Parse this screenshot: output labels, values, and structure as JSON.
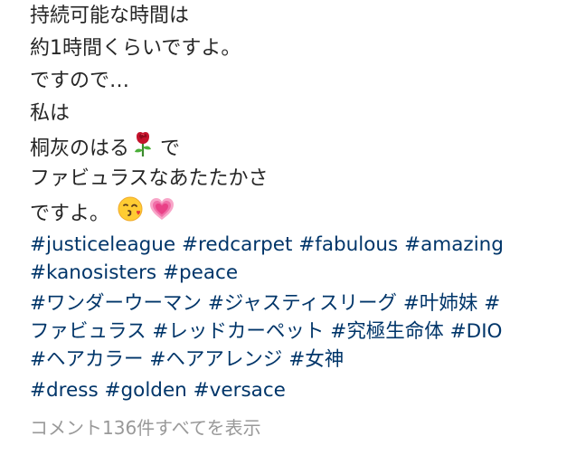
{
  "caption": {
    "lines": [
      "持続可能な時間は",
      "約1時間くらいですよ。",
      "ですので…",
      "私は",
      "桐灰のはる",
      "ファビュラスなあたたかさ",
      "ですよ。"
    ],
    "line5_suffix": "で",
    "emojis": [
      "rose-emoji",
      "kissing-face-emoji",
      "growing-heart-emoji"
    ]
  },
  "hashtags": {
    "rows": [
      [
        "#justiceleague",
        "#redcarpet",
        "#fabulous",
        "#amazing"
      ],
      [
        "#kanosisters",
        "#peace"
      ],
      [
        "#ワンダーウーマン",
        "#ジャスティスリーグ",
        "#叶姉妹",
        "#"
      ],
      [
        "ファビュラス",
        "#レッドカーペット",
        "#究極生命体",
        "#DIO"
      ],
      [
        "#ヘアカラー",
        "#ヘアアレンジ",
        "#女神"
      ],
      [
        "#dress",
        "#golden",
        "#versace"
      ]
    ]
  },
  "comments": {
    "view_all_label": "コメント136件すべてを表示"
  },
  "colors": {
    "text": "#262626",
    "hashtag": "#003569",
    "muted": "#999999"
  }
}
